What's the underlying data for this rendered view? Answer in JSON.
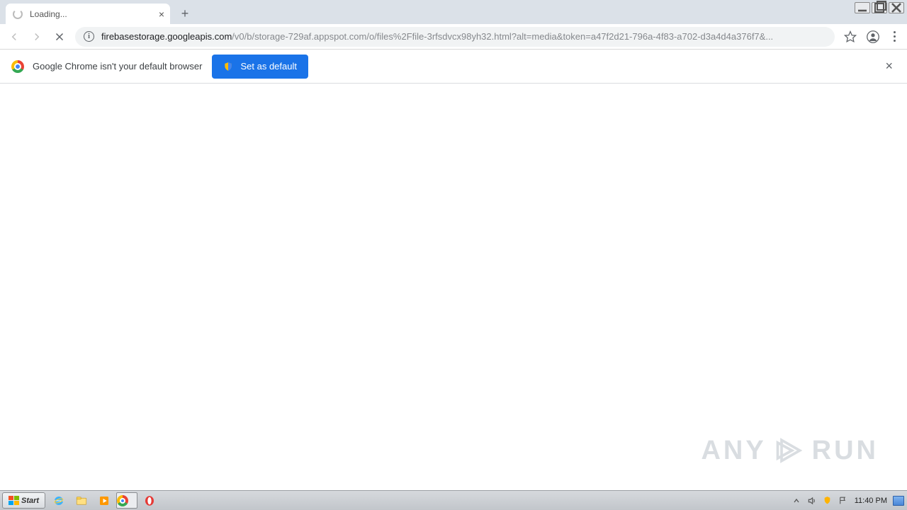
{
  "tab": {
    "title": "Loading..."
  },
  "toolbar": {
    "url_host": "firebasestorage.googleapis.com",
    "url_path": "/v0/b/storage-729af.appspot.com/o/files%2Ffile-3rfsdvcx98yh32.html?alt=media&token=a47f2d21-796a-4f83-a702-d3a4d4a376f7&..."
  },
  "infobar": {
    "message": "Google Chrome isn't your default browser",
    "button": "Set as default"
  },
  "watermark": {
    "left": "ANY",
    "right": "RUN"
  },
  "taskbar": {
    "start": "Start",
    "clock": "11:40 PM"
  }
}
